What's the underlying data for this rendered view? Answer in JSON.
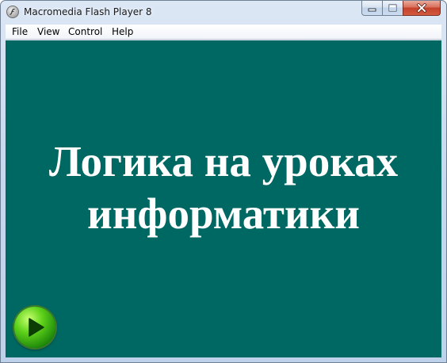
{
  "window": {
    "title": "Macromedia Flash Player 8",
    "icon": "flash-player-icon",
    "controls": {
      "minimize_icon": "minimize-icon",
      "maximize_icon": "maximize-icon",
      "close_icon": "close-icon"
    }
  },
  "menu": {
    "items": [
      {
        "label": "File"
      },
      {
        "label": "View"
      },
      {
        "label": "Control"
      },
      {
        "label": "Help"
      }
    ]
  },
  "stage": {
    "background_color": "#006862",
    "title_lines": [
      "Логика на уроках",
      "информатики"
    ],
    "title_color": "#ffffff",
    "play_button_icon": "play-icon",
    "play_button_color": "#3fbf12"
  }
}
